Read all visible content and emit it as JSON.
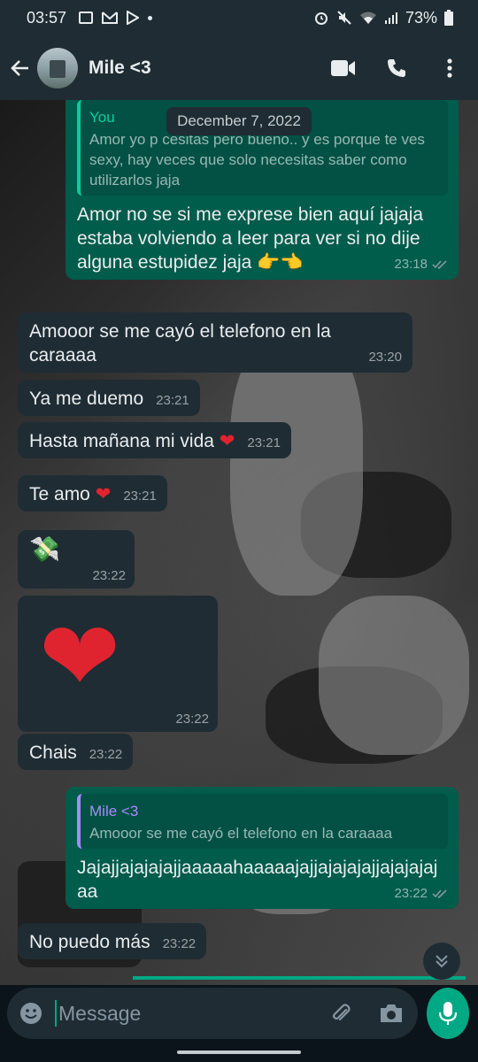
{
  "status_bar": {
    "time": "03:57",
    "battery": "73%"
  },
  "header": {
    "contact_name": "Mile <3"
  },
  "date_chip": "December 7, 2022",
  "messages": [
    {
      "direction": "out",
      "quote_name": "You",
      "quote_text": "Amor yo p           cesitas pero bueno.. y es porque te ves sexy, hay veces que solo necesitas saber como utilizarlos jaja",
      "text": "Amor no se si me exprese bien aquí jajaja estaba volviendo a leer para ver si no dije alguna estupidez jaja 👉👈",
      "time": "23:18"
    },
    {
      "direction": "in",
      "text": "Amooor se me cayó el telefono en la caraaaa",
      "time": "23:20"
    },
    {
      "direction": "in",
      "text": "Ya me duemo",
      "time": "23:21"
    },
    {
      "direction": "in",
      "text": "Hasta mañana mi vida",
      "emoji": "❤",
      "time": "23:21"
    },
    {
      "direction": "in",
      "text": "Te amo",
      "emoji": "❤",
      "time": "23:21"
    },
    {
      "direction": "in",
      "emoji": "💸",
      "time": "23:22"
    },
    {
      "direction": "in",
      "emoji": "❤",
      "time": "23:22"
    },
    {
      "direction": "in",
      "text": "Chais",
      "time": "23:22"
    },
    {
      "direction": "out",
      "quote_name": "Mile <3",
      "quote_text": "Amooor se me cayó el telefono en la caraaaa",
      "text": "Jajajjajajajajjaaaaahaaaaajajjajajajajjajajajajaa",
      "time": "23:22"
    },
    {
      "direction": "in",
      "text": "No puedo más",
      "time": "23:22"
    }
  ],
  "composer": {
    "placeholder": "Message"
  },
  "colors": {
    "accent": "#00a884",
    "incoming_bubble": "#1f2c34",
    "outgoing_bubble": "#005c4b",
    "header_bg": "#1f2c34"
  },
  "icons": [
    "back-arrow-icon",
    "video-call-icon",
    "phone-icon",
    "more-vert-icon",
    "emoji-icon",
    "attach-icon",
    "camera-icon",
    "mic-icon",
    "scroll-down-icon"
  ]
}
